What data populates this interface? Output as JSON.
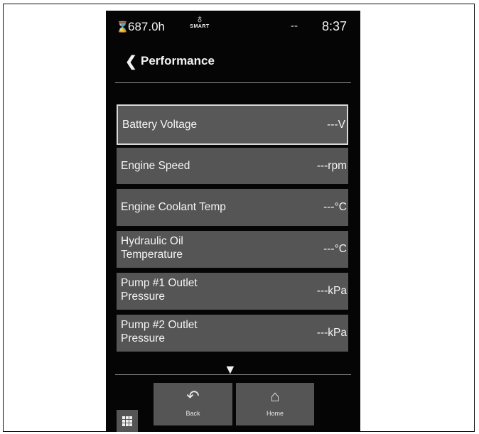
{
  "status_bar": {
    "hourglass_icon": "hourglass-icon",
    "engine_hours": "687.0h",
    "smart_label": "SMART",
    "indicator": "--",
    "time": "8:37"
  },
  "header": {
    "back_chevron": "<",
    "title": "Performance"
  },
  "parameters": [
    {
      "label": "Battery Voltage",
      "value": "---V"
    },
    {
      "label": "Engine Speed",
      "value": "---rpm"
    },
    {
      "label": "Engine Coolant Temp",
      "value": "---°C"
    },
    {
      "label": "Hydraulic Oil Temperature",
      "value": "---°C"
    },
    {
      "label": "Pump #1 Outlet Pressure",
      "value": "---kPa"
    },
    {
      "label": "Pump #2 Outlet Pressure",
      "value": "---kPa"
    }
  ],
  "footer": {
    "back_label": "Back",
    "home_label": "Home"
  },
  "colors": {
    "screen_bg": "#050505",
    "item_bg": "#555555",
    "text": "#f2f2f2"
  }
}
